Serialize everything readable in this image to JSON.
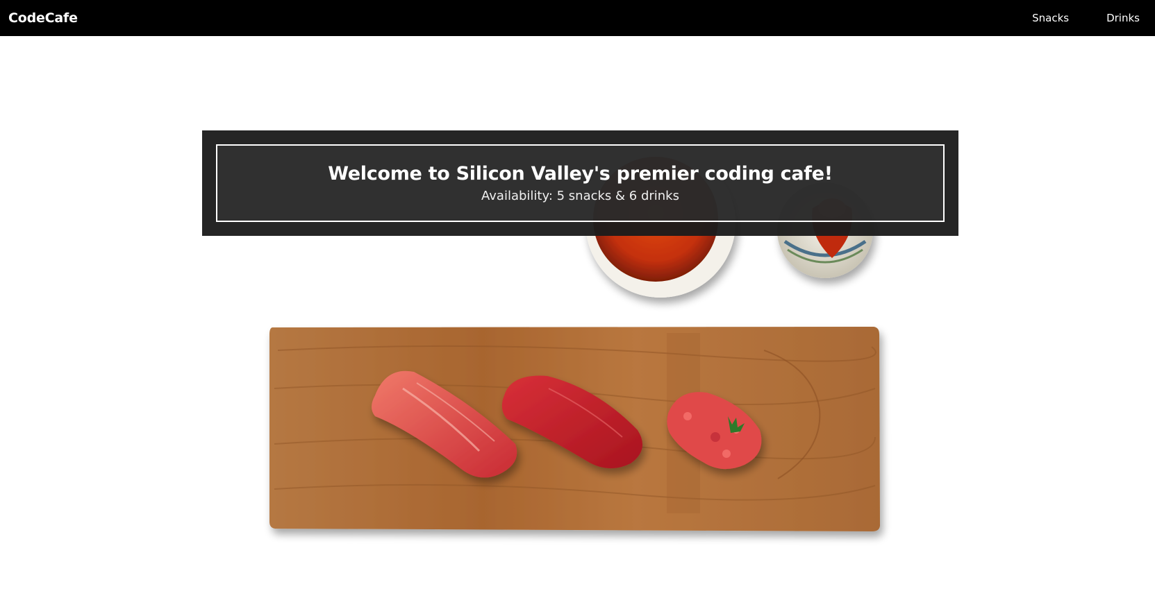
{
  "nav": {
    "brand": "CodeCafe",
    "links": [
      "Snacks",
      "Drinks"
    ]
  },
  "hero": {
    "title": "Welcome to Silicon Valley's premier coding cafe!",
    "subtitle": "Availability: 5 snacks & 6 drinks"
  },
  "colors": {
    "navbar_bg": "#000000",
    "banner_bg": "#1c1c1c",
    "board": "#b0713a",
    "tuna": "#c8262c"
  },
  "icons": [
    "sushi-board-image",
    "soy-sauce-bowl-image",
    "sauce-jar-image"
  ]
}
